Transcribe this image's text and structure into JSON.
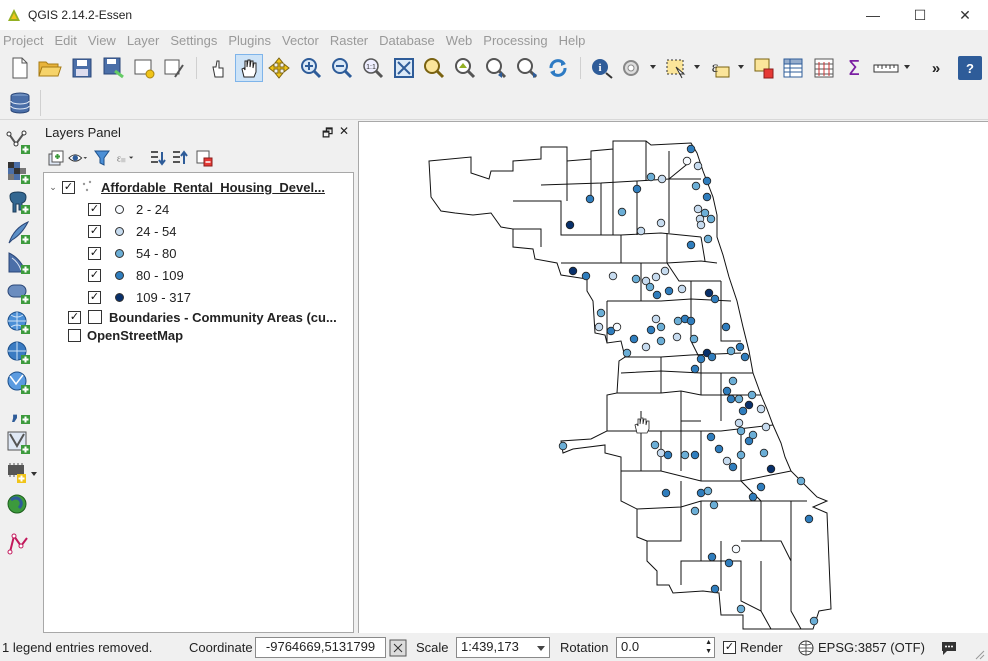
{
  "window": {
    "title": "QGIS 2.14.2-Essen",
    "minimize": "—",
    "maximize": "☐",
    "close": "✕"
  },
  "menu": [
    "Project",
    "Edit",
    "View",
    "Layer",
    "Settings",
    "Plugins",
    "Vector",
    "Raster",
    "Database",
    "Web",
    "Processing",
    "Help"
  ],
  "toolbar": {
    "overflow": "»",
    "help_label": "?"
  },
  "layers_panel": {
    "title": "Layers Panel",
    "float_icon": "🗗",
    "close_icon": "✕",
    "layers": [
      {
        "name": "Affordable_Rental_Housing_Devel...",
        "checked": true,
        "expanded": true,
        "classes": [
          {
            "label": "2 - 24",
            "color": "#f7fbff"
          },
          {
            "label": "24 - 54",
            "color": "#c6dbef"
          },
          {
            "label": "54 - 80",
            "color": "#6baed6"
          },
          {
            "label": "80 - 109",
            "color": "#2f7dbd"
          },
          {
            "label": "109 - 317",
            "color": "#08306b"
          }
        ]
      },
      {
        "name": "Boundaries - Community Areas (cu...",
        "checked": true
      },
      {
        "name": "OpenStreetMap",
        "checked": false
      }
    ]
  },
  "statusbar": {
    "message": "1 legend entries removed.",
    "coordinate_label": "Coordinate",
    "coordinate_value": "-9764669,5131799",
    "scale_label": "Scale",
    "scale_value": "1:439,173",
    "rotation_label": "Rotation",
    "rotation_value": "0.0",
    "render_label": "Render",
    "render_checked": true,
    "crs": "EPSG:3857 (OTF)"
  },
  "map": {
    "points": [
      [
        690,
        148,
        4
      ],
      [
        686,
        160,
        1
      ],
      [
        697,
        165,
        2
      ],
      [
        661,
        178,
        2
      ],
      [
        636,
        188,
        4
      ],
      [
        650,
        176,
        3
      ],
      [
        706,
        180,
        4
      ],
      [
        695,
        185,
        3
      ],
      [
        706,
        196,
        4
      ],
      [
        697,
        208,
        2
      ],
      [
        704,
        212,
        3
      ],
      [
        699,
        218,
        2
      ],
      [
        710,
        218,
        3
      ],
      [
        700,
        224,
        2
      ],
      [
        589,
        198,
        4
      ],
      [
        621,
        211,
        3
      ],
      [
        660,
        222,
        2
      ],
      [
        569,
        224,
        5
      ],
      [
        640,
        230,
        2
      ],
      [
        690,
        244,
        4
      ],
      [
        707,
        238,
        3
      ],
      [
        572,
        270,
        5
      ],
      [
        585,
        275,
        4
      ],
      [
        612,
        275,
        2
      ],
      [
        635,
        278,
        3
      ],
      [
        645,
        280,
        2
      ],
      [
        655,
        276,
        2
      ],
      [
        664,
        270,
        2
      ],
      [
        649,
        286,
        3
      ],
      [
        656,
        294,
        4
      ],
      [
        668,
        290,
        4
      ],
      [
        681,
        288,
        2
      ],
      [
        708,
        292,
        5
      ],
      [
        714,
        298,
        4
      ],
      [
        600,
        312,
        3
      ],
      [
        598,
        326,
        2
      ],
      [
        610,
        330,
        4
      ],
      [
        616,
        326,
        1
      ],
      [
        655,
        318,
        2
      ],
      [
        677,
        320,
        3
      ],
      [
        684,
        318,
        4
      ],
      [
        690,
        320,
        4
      ],
      [
        650,
        329,
        4
      ],
      [
        660,
        326,
        3
      ],
      [
        633,
        338,
        4
      ],
      [
        626,
        352,
        3
      ],
      [
        645,
        346,
        2
      ],
      [
        660,
        340,
        3
      ],
      [
        676,
        336,
        2
      ],
      [
        693,
        338,
        3
      ],
      [
        725,
        326,
        4
      ],
      [
        739,
        346,
        4
      ],
      [
        730,
        350,
        3
      ],
      [
        706,
        352,
        5
      ],
      [
        700,
        358,
        4
      ],
      [
        711,
        356,
        4
      ],
      [
        694,
        368,
        4
      ],
      [
        744,
        356,
        4
      ],
      [
        732,
        380,
        3
      ],
      [
        726,
        390,
        4
      ],
      [
        730,
        398,
        4
      ],
      [
        738,
        398,
        3
      ],
      [
        742,
        410,
        4
      ],
      [
        748,
        404,
        5
      ],
      [
        751,
        394,
        3
      ],
      [
        760,
        408,
        2
      ],
      [
        738,
        422,
        2
      ],
      [
        740,
        430,
        3
      ],
      [
        748,
        440,
        4
      ],
      [
        752,
        434,
        3
      ],
      [
        763,
        452,
        3
      ],
      [
        765,
        426,
        2
      ],
      [
        710,
        436,
        4
      ],
      [
        718,
        448,
        4
      ],
      [
        726,
        460,
        2
      ],
      [
        732,
        466,
        4
      ],
      [
        740,
        454,
        3
      ],
      [
        770,
        468,
        5
      ],
      [
        800,
        480,
        3
      ],
      [
        654,
        444,
        3
      ],
      [
        660,
        452,
        2
      ],
      [
        667,
        454,
        4
      ],
      [
        684,
        454,
        3
      ],
      [
        694,
        454,
        4
      ],
      [
        640,
        426,
        3
      ],
      [
        562,
        445,
        3
      ],
      [
        665,
        492,
        4
      ],
      [
        700,
        492,
        4
      ],
      [
        707,
        490,
        3
      ],
      [
        713,
        504,
        3
      ],
      [
        694,
        510,
        3
      ],
      [
        752,
        496,
        4
      ],
      [
        760,
        486,
        4
      ],
      [
        808,
        518,
        4
      ],
      [
        711,
        556,
        4
      ],
      [
        728,
        562,
        4
      ],
      [
        735,
        548,
        1
      ],
      [
        714,
        588,
        4
      ],
      [
        740,
        608,
        3
      ],
      [
        813,
        620,
        3
      ]
    ]
  }
}
